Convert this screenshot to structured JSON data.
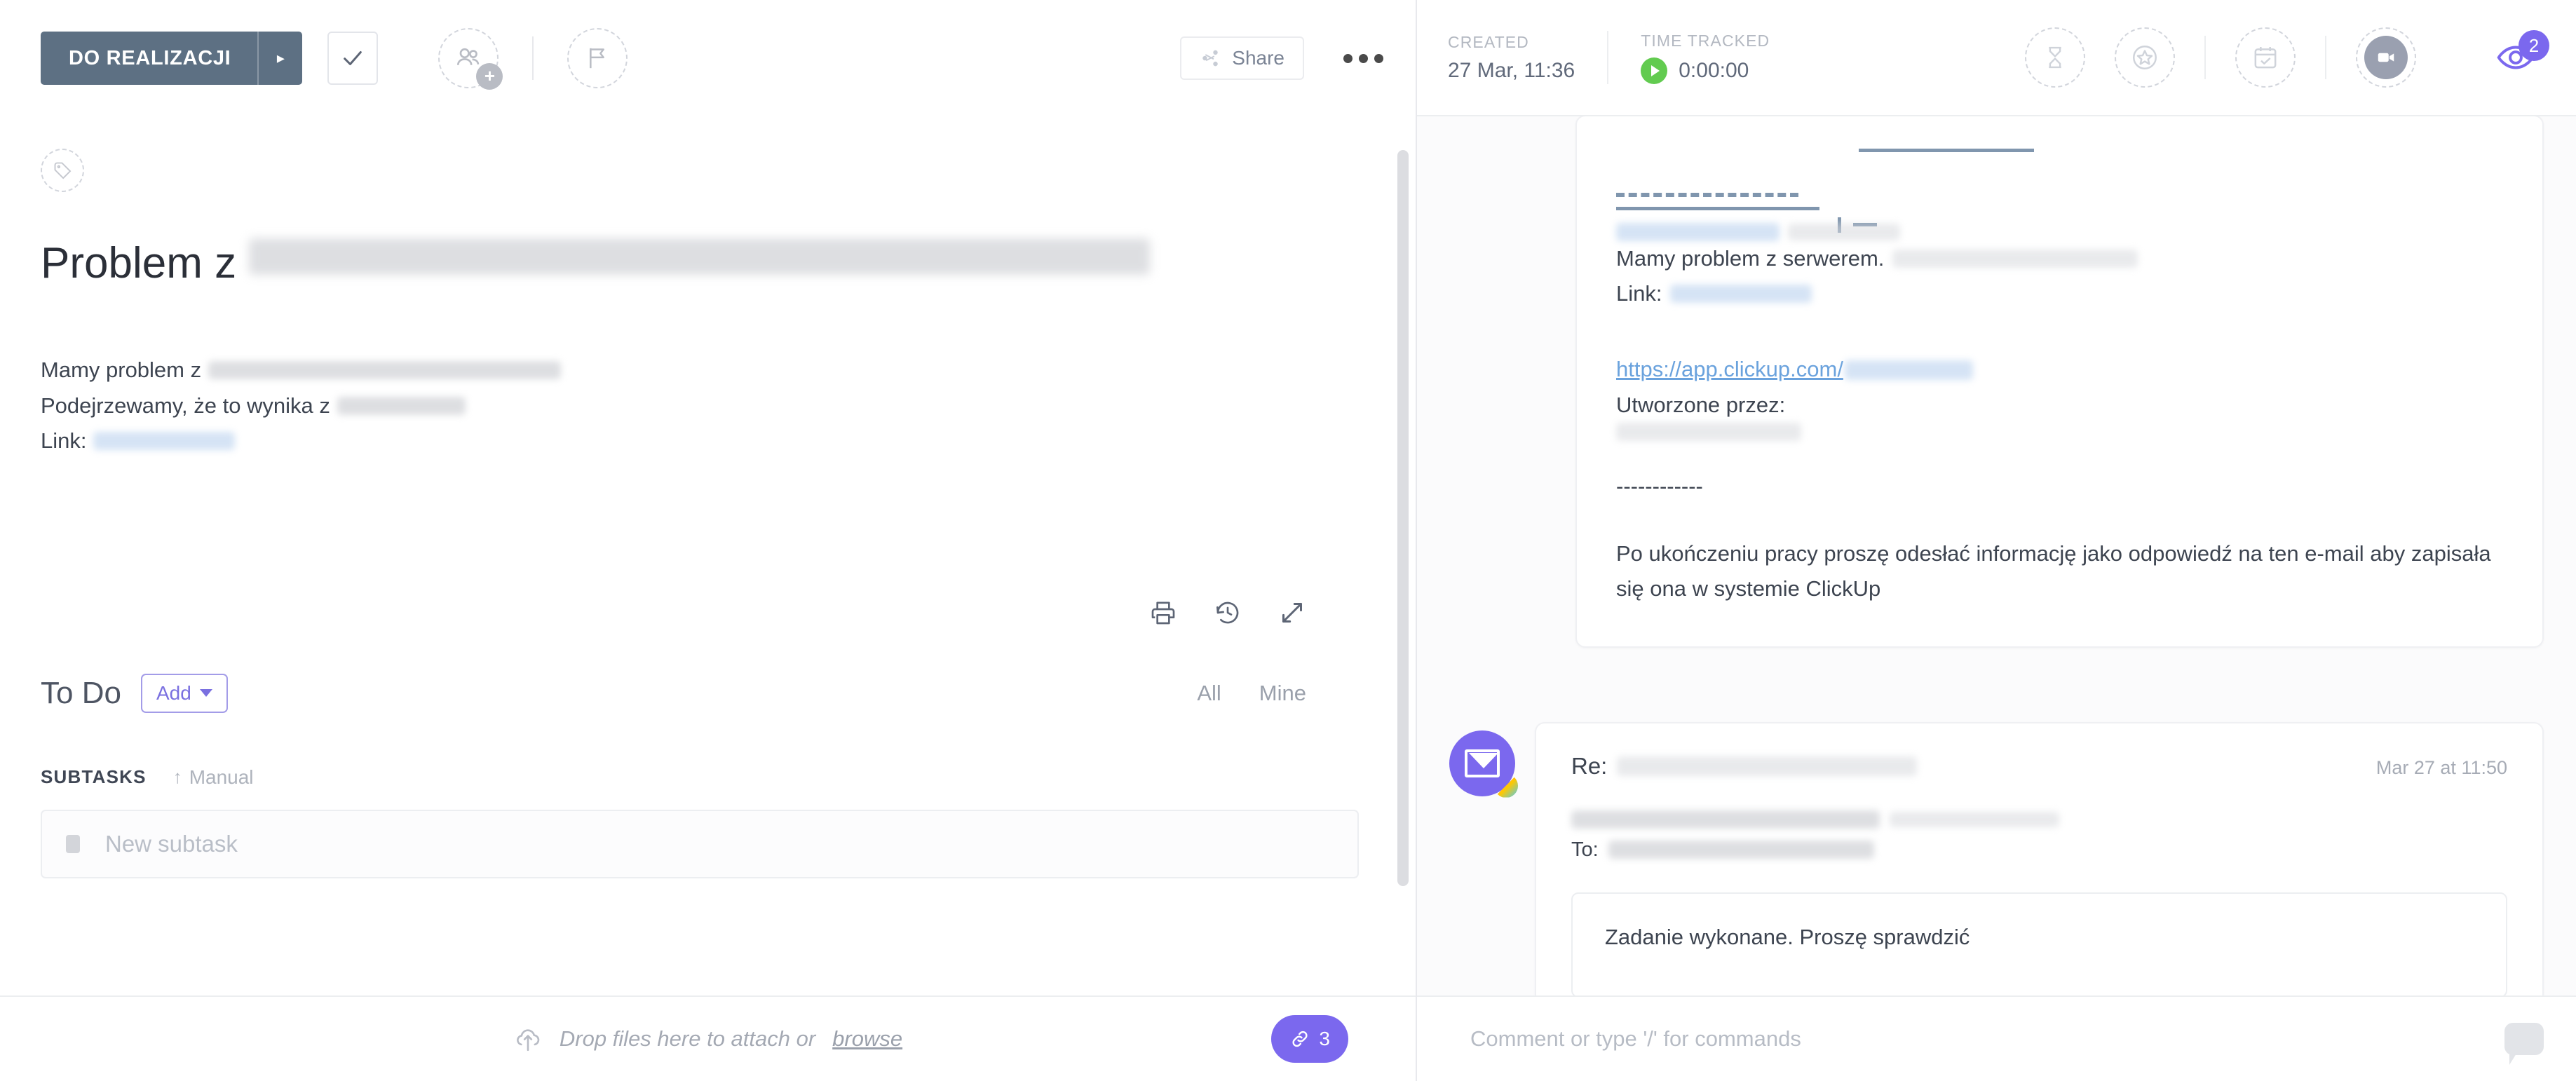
{
  "left": {
    "toolbar": {
      "status_label": "DO REALIZACJI",
      "status_caret": "▸",
      "complete_icon": "check-icon",
      "assignee_icon": "add-assignee-icon",
      "priority_icon": "flag-icon",
      "share_label": "Share",
      "more_label": "•••"
    },
    "tag_icon": "tag-icon",
    "title": {
      "visible": "Problem z",
      "redacted": "serwerem w sobotne 27.17CMD Network 2021"
    },
    "description": {
      "line1_visible": "Mamy problem z",
      "line1_redacted": "serwerem. Testowa nazwa problemu",
      "line2_visible": "Podejrzewamy, że to wynika z",
      "line2_redacted": "ustawień php",
      "line3_visible": "Link:",
      "line3_redacted": "www.mentor.pl"
    },
    "description_actions": {
      "print_icon": "print-icon",
      "history_icon": "history-icon",
      "expand_icon": "expand-icon"
    },
    "todo": {
      "label": "To Do",
      "add_label": "Add",
      "filter_all": "All",
      "filter_mine": "Mine"
    },
    "subtasks": {
      "header": "SUBTASKS",
      "sort_arrow": "↑",
      "sort_label": "Manual",
      "new_subtask_placeholder": "New subtask"
    },
    "footer": {
      "drop_text_before": "Drop files here to attach or",
      "browse_label": "browse",
      "upload_icon": "upload-cloud-icon",
      "attachment_icon": "link-icon",
      "attachment_count": "3"
    }
  },
  "right": {
    "header": {
      "created_label": "CREATED",
      "created_value": "27 Mar, 11:36",
      "time_tracked_label": "TIME TRACKED",
      "time_tracked_value": "0:00:00",
      "play_icon": "play-icon",
      "estimate_icon": "hourglass-icon",
      "points_icon": "star-circle-icon",
      "due_date_icon": "calendar-check-icon",
      "record_icon": "video-camera-icon",
      "watchers_icon": "eye-icon",
      "watchers_count": "2"
    },
    "email_1": {
      "quoted_subject_redacted": "Testowy problem",
      "quoted_subject_tail_redacted": "z serwerem",
      "body_line1_visible": "Mamy problem z serwerem.",
      "body_line1_redacted": "Testowa nazwa problemu",
      "body_line2_visible": "Link:",
      "body_line2_redacted": "www.mentor.pl",
      "clickup_url_visible": "https://app.clickup.com/",
      "clickup_url_redacted": "863bj2ywnau",
      "created_by_label": "Utworzone przez:",
      "created_by_redacted": "Leszek Szczerbicki",
      "divider": "------------",
      "closing": "Po ukończeniu pracy proszę odesłać informację jako odpowiedź na ten e-mail aby zapisała się ona w systemie ClickUp"
    },
    "email_2": {
      "avatar_icon": "email-avatar-icon",
      "subject_prefix": "Re:",
      "subject_redacted": "Testowy problem z serwerem",
      "date": "Mar 27 at 11:50",
      "from_redacted": "Mentor - Cyfryzujemy zarządzanie",
      "from_email_redacted": "kontakt@mentor.pl",
      "to_label": "To:",
      "to_redacted": "jantestowy20401@gmail.com",
      "reply_text": "Zadanie wykonane. Proszę sprawdzić"
    },
    "footer": {
      "comment_placeholder": "Comment or type '/' for commands",
      "comment_bubble_icon": "comment-bubble-icon"
    }
  },
  "colors": {
    "status_pill": "#5d7083",
    "accent_purple": "#7b68ee",
    "green": "#62cb50",
    "link_blue": "#6aa2dd"
  }
}
